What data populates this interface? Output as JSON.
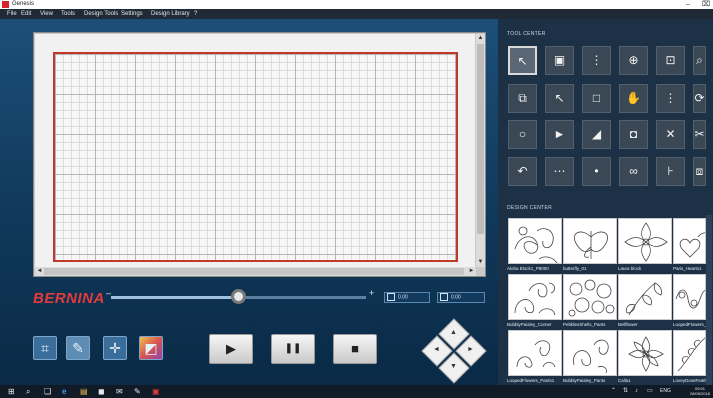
{
  "window": {
    "title": "Genesis",
    "minimize": "–",
    "close": "⌧"
  },
  "menu": [
    "File",
    "Edit",
    "View",
    "Tools",
    "Design Tools",
    "Settings",
    "Design Library",
    "?"
  ],
  "brand": {
    "name": "BERNINA",
    "color": "#e23b3b"
  },
  "zoom": {
    "minus": "–",
    "plus": "+",
    "level": 0.5
  },
  "readouts": [
    {
      "value": "0.00"
    },
    {
      "value": "0.00"
    }
  ],
  "canvas": {
    "border_color": "#c0392b"
  },
  "scroll": {
    "up": "▲",
    "down": "▼",
    "left": "◄",
    "right": "►"
  },
  "mode_buttons": [
    {
      "icon": "crop-icon",
      "glyph": "⌗"
    },
    {
      "icon": "pen-icon",
      "glyph": "✎"
    },
    {
      "icon": "crosshair-icon",
      "glyph": "✛"
    },
    {
      "icon": "gradient-icon",
      "glyph": "◩"
    }
  ],
  "playback": [
    {
      "icon": "play-icon",
      "glyph": "▶"
    },
    {
      "icon": "pause-icon",
      "glyph": "❚❚"
    },
    {
      "icon": "stop-icon",
      "glyph": "■"
    }
  ],
  "dpad": {
    "up": "▲",
    "down": "▼",
    "left": "◄",
    "right": "►"
  },
  "tool_center": {
    "title": "TOOL CENTER",
    "tools": [
      {
        "icon": "select-arrow-icon",
        "glyph": "↖"
      },
      {
        "icon": "node-edit-icon",
        "glyph": "▣"
      },
      {
        "icon": "delete-node-icon",
        "glyph": "⋮"
      },
      {
        "icon": "zoom-in-icon",
        "glyph": "⊕"
      },
      {
        "icon": "zoom-1to1-icon",
        "glyph": "⊡"
      },
      {
        "icon": "zoom-fit-icon",
        "glyph": "⌕"
      },
      {
        "icon": "move-icon",
        "glyph": "⧉"
      },
      {
        "icon": "pointer-icon",
        "glyph": "↖"
      },
      {
        "icon": "rectangle-select-icon",
        "glyph": "□"
      },
      {
        "icon": "hand-pan-icon",
        "glyph": "✋"
      },
      {
        "icon": "align-icon",
        "glyph": "⋮"
      },
      {
        "icon": "rotate-icon",
        "glyph": "⟳"
      },
      {
        "icon": "circle-icon",
        "glyph": "○"
      },
      {
        "icon": "flag-icon",
        "glyph": "►"
      },
      {
        "icon": "shape-icon",
        "glyph": "◢"
      },
      {
        "icon": "square-node-icon",
        "glyph": "◘"
      },
      {
        "icon": "scatter-icon",
        "glyph": "✕"
      },
      {
        "icon": "scissors-icon",
        "glyph": "✂"
      },
      {
        "icon": "undo-icon",
        "glyph": "↶"
      },
      {
        "icon": "stitch-icon",
        "glyph": "⋯"
      },
      {
        "icon": "dot-icon",
        "glyph": "•"
      },
      {
        "icon": "link-icon",
        "glyph": "∞"
      },
      {
        "icon": "ruler-icon",
        "glyph": "⊦"
      },
      {
        "icon": "export-icon",
        "glyph": "⧈"
      }
    ]
  },
  "design_center": {
    "title": "DESIGN CENTER",
    "designs": [
      {
        "label": "Aloha Block1_P8000"
      },
      {
        "label": "butterfly_01"
      },
      {
        "label": "Laura block"
      },
      {
        "label": "Paris_Hearts1"
      },
      {
        "label": "BubblyPaisley_Corner"
      },
      {
        "label": "PebblesShells_Pants"
      },
      {
        "label": "Bellflower"
      },
      {
        "label": "LoopedFlowers_Bo"
      },
      {
        "label": "LoopedFlowers_Pants1"
      },
      {
        "label": "BubblyPaisley_Pants"
      },
      {
        "label": "Calla1"
      },
      {
        "label": "LoveyDoveFeathers"
      }
    ]
  },
  "taskbar": {
    "icons": [
      "windows-icon",
      "search-icon",
      "task-view-icon",
      "edge-icon",
      "explorer-icon",
      "store-icon",
      "mail-icon",
      "pen-icon",
      "genesis-icon"
    ],
    "glyphs": [
      "⊞",
      "⌕",
      "❑",
      "e",
      "▤",
      "◼",
      "✉",
      "✎",
      "▣"
    ],
    "tray": [
      "⌃",
      "⇅",
      "♪",
      "▭",
      "ENG"
    ],
    "time": "09:01",
    "date": "28/05/2018"
  }
}
